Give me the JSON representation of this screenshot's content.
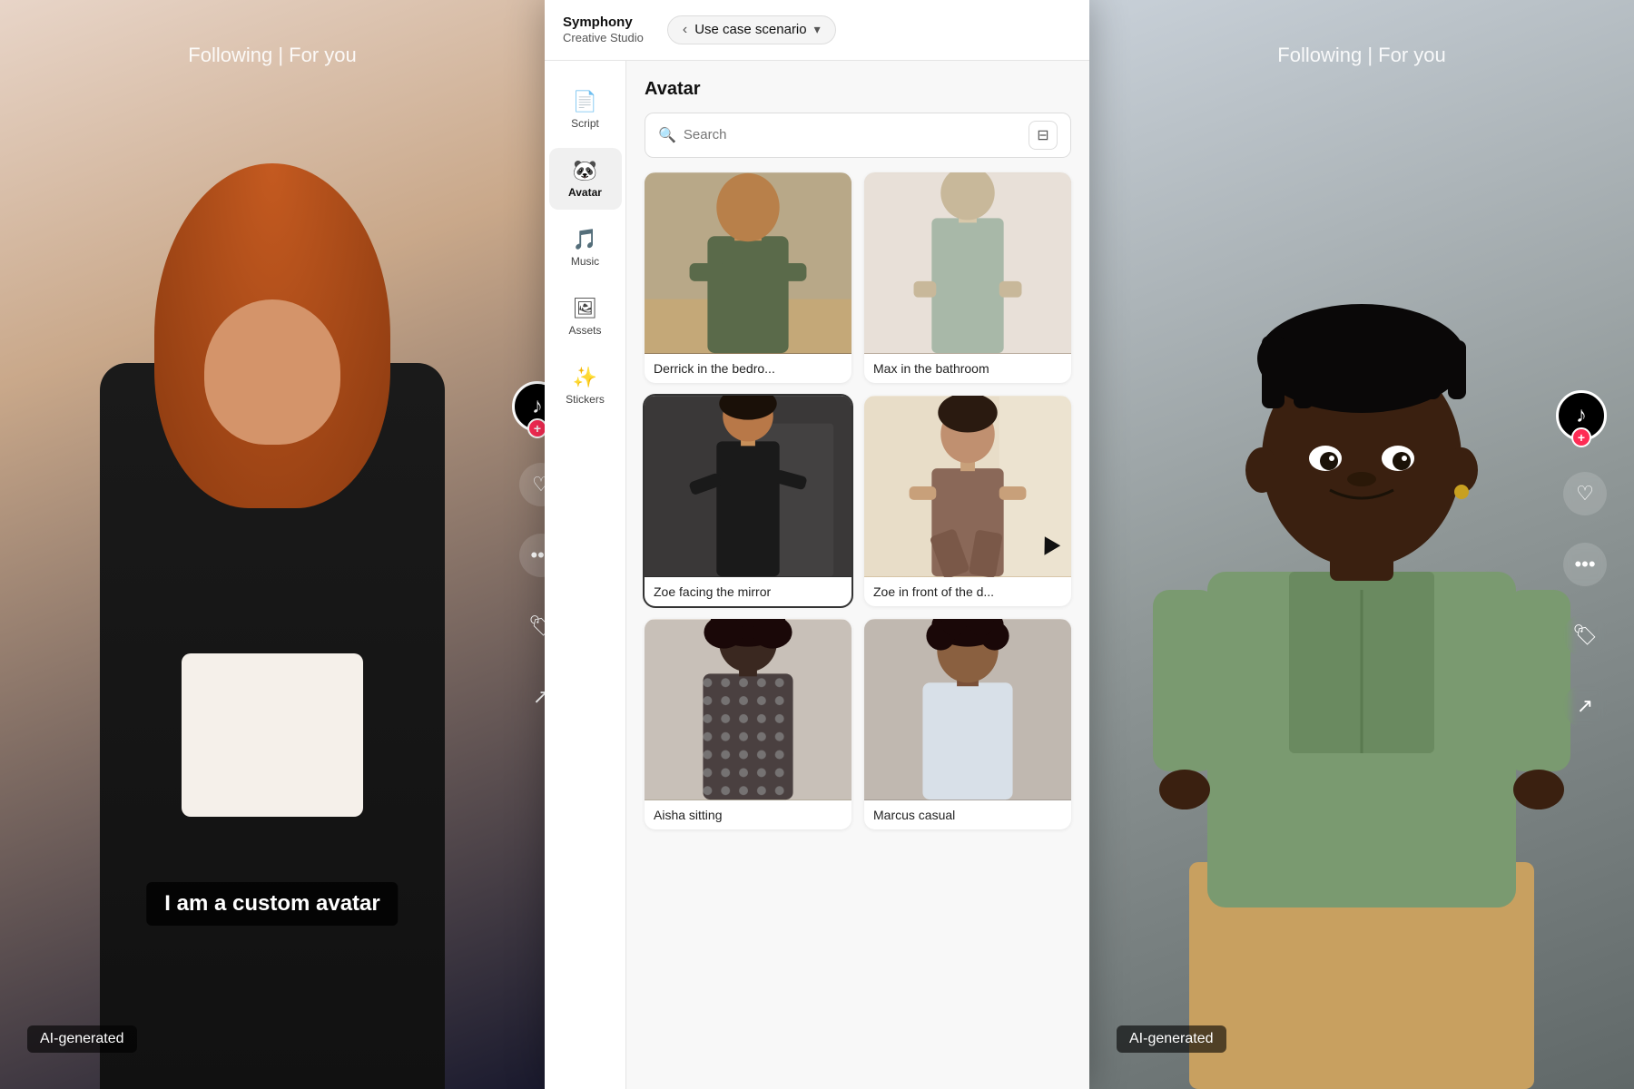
{
  "left_panel": {
    "following_text": "Following | For you",
    "caption": "I am a custom avatar",
    "ai_badge": "AI-generated"
  },
  "center_panel": {
    "brand": {
      "name": "Symphony",
      "subtitle": "Creative Studio"
    },
    "nav": {
      "back_label": "‹",
      "label": "Use case scenario",
      "dropdown": "▾"
    },
    "sidebar": {
      "items": [
        {
          "icon": "📄",
          "label": "Script"
        },
        {
          "icon": "🐼",
          "label": "Avatar",
          "active": true
        },
        {
          "icon": "🎵",
          "label": "Music"
        },
        {
          "icon": "🖼",
          "label": "Assets"
        },
        {
          "icon": "✨",
          "label": "Stickers"
        }
      ]
    },
    "main": {
      "section_title": "Avatar",
      "search_placeholder": "Search",
      "filter_icon": "⊟",
      "avatars": [
        {
          "label": "Derrick in the bedro...",
          "bg": "derrick"
        },
        {
          "label": "Max in the bathroom",
          "bg": "max"
        },
        {
          "label": "Zoe facing the mirror",
          "bg": "zoe1"
        },
        {
          "label": "Zoe in front of the d...",
          "bg": "zoe2"
        },
        {
          "label": "Aisha sitting",
          "bg": "dark1"
        },
        {
          "label": "Marcus casual",
          "bg": "curly"
        }
      ]
    }
  },
  "right_panel": {
    "following_text": "Following | For you",
    "ai_badge": "AI-generated"
  },
  "tiktok": {
    "plus": "+"
  },
  "icons": {
    "heart": "♡",
    "comment": "···",
    "bookmark": "🔖",
    "share": "↗"
  }
}
